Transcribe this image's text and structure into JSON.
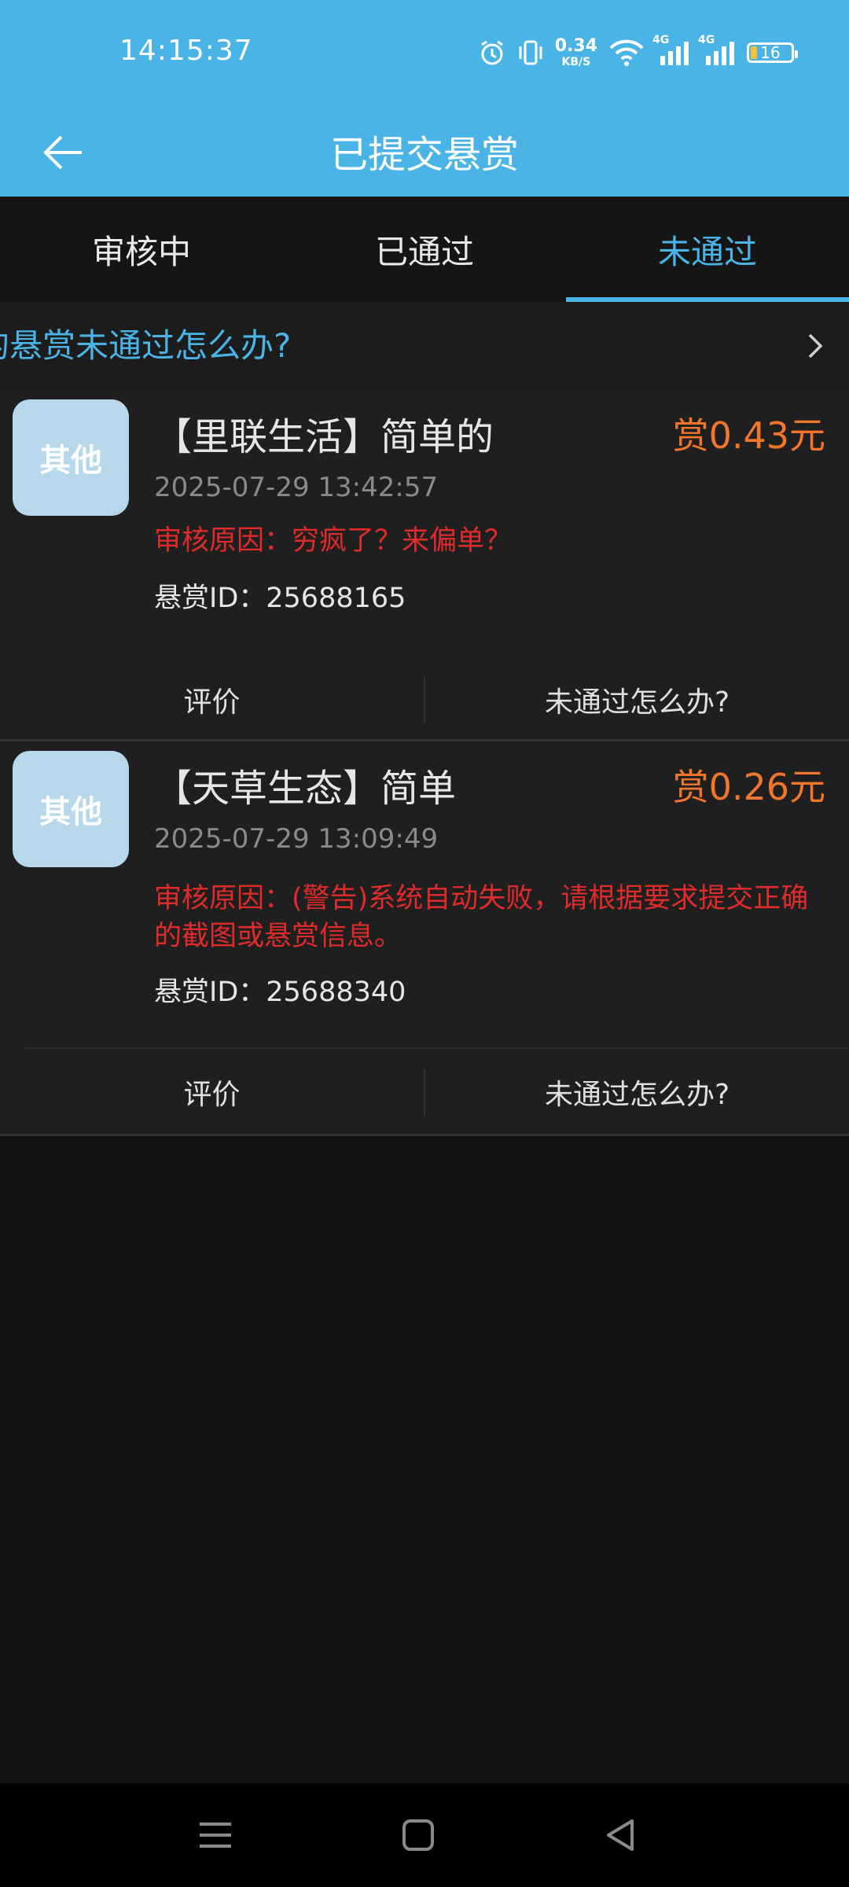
{
  "status_bar": {
    "time": "14:15:37",
    "net_speed_value": "0.34",
    "net_speed_unit": "KB/S",
    "signal_label_1": "4G",
    "signal_label_2": "4G",
    "battery_level": "16"
  },
  "header": {
    "title": "已提交悬赏"
  },
  "tabs": [
    {
      "label": "审核中",
      "active": false
    },
    {
      "label": "已通过",
      "active": false
    },
    {
      "label": "未通过",
      "active": true
    }
  ],
  "notice": {
    "text": "的悬赏未通过怎么办?"
  },
  "cards": [
    {
      "badge": "其他",
      "title": "【里联生活】简单的",
      "reward": "赏0.43元",
      "time": "2025-07-29 13:42:57",
      "reason": "审核原因：穷疯了？来偏单？",
      "id_text": "悬赏ID：25688165",
      "action_review": "评价",
      "action_help": "未通过怎么办?"
    },
    {
      "badge": "其他",
      "title": "【天草生态】简单",
      "reward": "赏0.26元",
      "time": "2025-07-29 13:09:49",
      "reason": "审核原因：(警告)系统自动失败，请根据要求提交正确的截图或悬赏信息。",
      "id_text": "悬赏ID：25688340",
      "action_review": "评价",
      "action_help": "未通过怎么办?"
    }
  ],
  "colors": {
    "accent": "#4ab4e6",
    "reward": "#f2752c",
    "reason": "#e12b2b"
  }
}
